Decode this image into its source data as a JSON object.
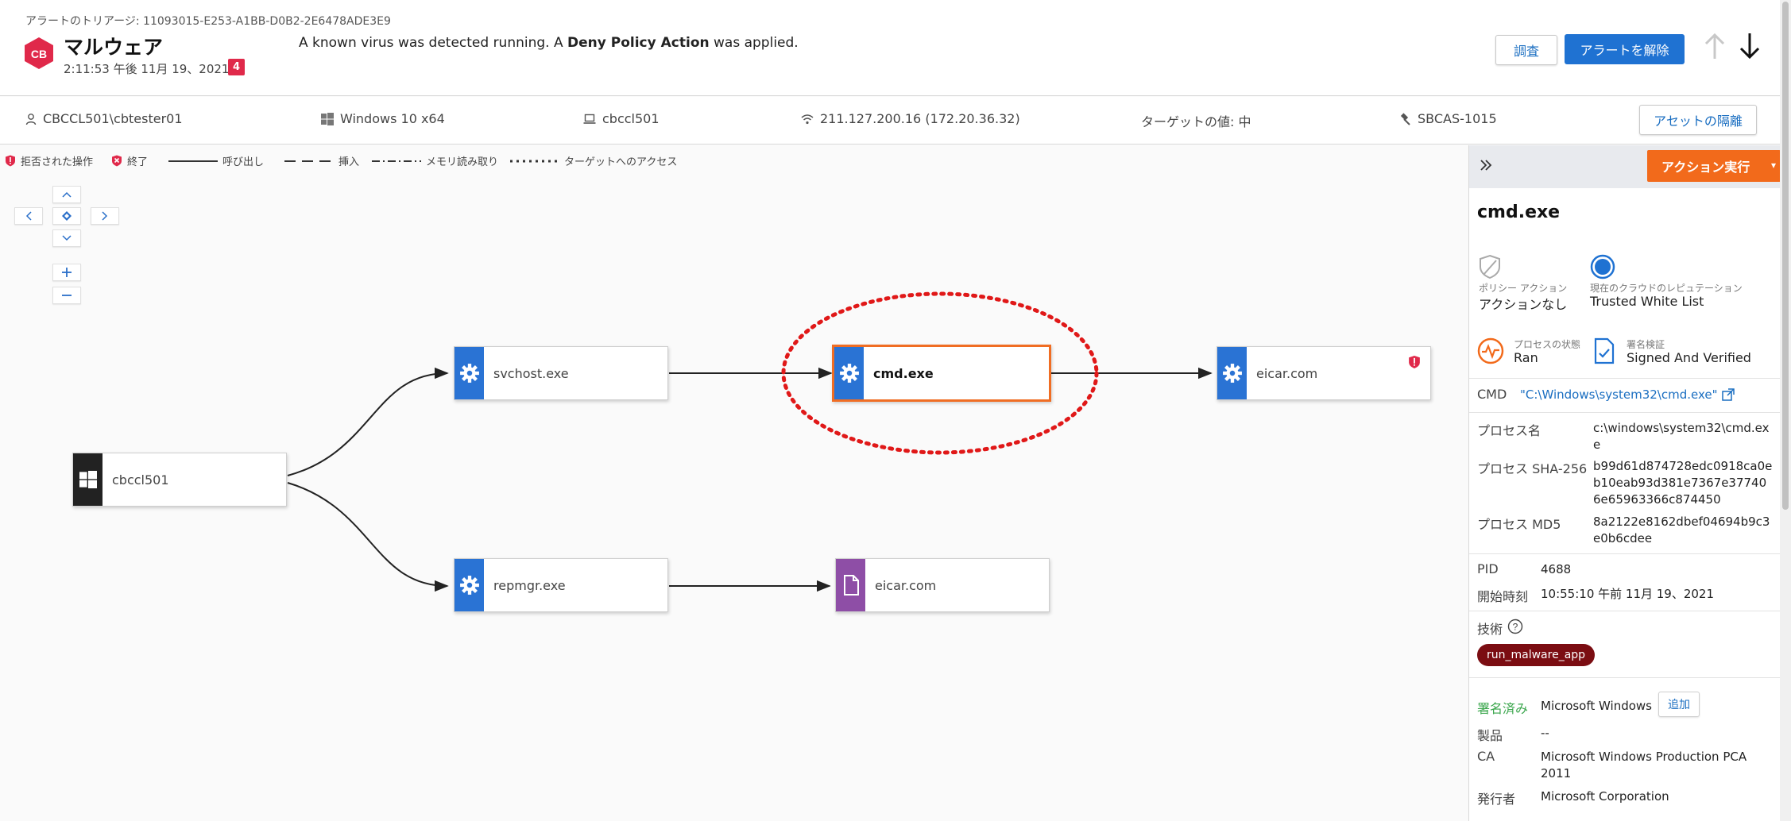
{
  "header": {
    "breadcrumb": "アラートのトリアージ: 11093015-E253-A1BB-D0B2-2E6478ADE3E9",
    "logo_text": "CB",
    "title": "マルウェア",
    "timestamp": "2:11:53 午後 11月 19、2021",
    "count": "4",
    "message_prefix": "A known virus was detected running. A ",
    "message_bold": "Deny Policy Action",
    "message_suffix": " was applied.",
    "investigate_label": "調査",
    "dismiss_label": "アラートを解除",
    "brand_color": "#e0294a"
  },
  "asset_bar": {
    "user": "CBCCL501\\cbtester01",
    "os": "Windows 10 x64",
    "device": "cbccl501",
    "ip": "211.127.200.16 (172.20.36.32)",
    "target_value": "ターゲットの値: 中",
    "policy": "SBCAS-1015",
    "isolate_label": "アセットの隔離"
  },
  "legend": {
    "denied": "拒否された操作",
    "terminated": "終了",
    "invoke": "呼び出し",
    "inject": "挿入",
    "memory_read": "メモリ読み取り",
    "target_access": "ターゲットへのアクセス"
  },
  "graph": {
    "nodes": {
      "root": "cbccl501",
      "svchost": "svchost.exe",
      "cmd": "cmd.exe",
      "eicar_top": "eicar.com",
      "repmgr": "repmgr.exe",
      "eicar_bottom": "eicar.com"
    }
  },
  "panel": {
    "action_label": "アクション実行",
    "title": "cmd.exe",
    "policy_action_label": "ポリシー アクション",
    "policy_action_value": "アクションなし",
    "reputation_label": "現在のクラウドのレピュテーション",
    "reputation_value": "Trusted White List",
    "process_state_label": "プロセスの状態",
    "process_state_value": "Ran",
    "signature_label": "署名検証",
    "signature_value": "Signed And Verified",
    "cmd_label": "CMD",
    "cmd_value": "\"C:\\Windows\\system32\\cmd.exe\"",
    "process_name_label": "プロセス名",
    "process_name_value": "c:\\windows\\system32\\cmd.exe",
    "sha256_label": "プロセス SHA-256",
    "sha256_value": "b99d61d874728edc0918ca0eb10eab93d381e7367e377406e65963366c874450",
    "md5_label": "プロセス MD5",
    "md5_value": "8a2122e8162dbef04694b9c3e0b6cdee",
    "pid_label": "PID",
    "pid_value": "4688",
    "start_label": "開始時刻",
    "start_value": "10:55:10 午前 11月 19、2021",
    "technique_label": "技術",
    "technique_value": "run_malware_app",
    "signed_label": "署名済み",
    "signed_value": "Microsoft Windows",
    "add_label": "追加",
    "product_label": "製品",
    "product_value": "--",
    "ca_label": "CA",
    "ca_value": "Microsoft Windows Production PCA 2011",
    "publisher_label": "発行者",
    "publisher_value": "Microsoft Corporation"
  },
  "colors": {
    "accent_blue": "#1f72d2",
    "action_orange": "#f26a1b",
    "alert_red": "#e0294a",
    "selection_dashed": "#e01818",
    "signed_green": "#3aa64c"
  }
}
